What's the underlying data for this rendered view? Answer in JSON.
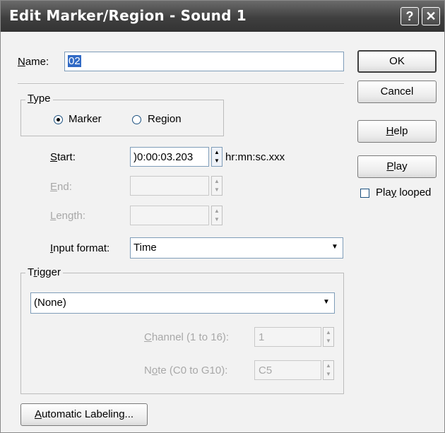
{
  "window": {
    "title": "Edit Marker/Region - Sound 1",
    "help_glyph": "?",
    "close_glyph": "✕"
  },
  "name": {
    "label_pre": "",
    "label_key": "N",
    "label_post": "ame:",
    "value": "02"
  },
  "type": {
    "group_key": "T",
    "group_rest": "ype",
    "marker_label": "Marker",
    "region_label": "Region",
    "selected": "Marker"
  },
  "start": {
    "key": "S",
    "rest": "tart:",
    "value": ")0:00:03.203",
    "format": "hr:mn:sc.xxx"
  },
  "end": {
    "key": "E",
    "rest": "nd:",
    "value": ""
  },
  "length": {
    "key": "L",
    "rest": "ength:",
    "value": ""
  },
  "input_format": {
    "key": "I",
    "rest": "nput format:",
    "value": "Time"
  },
  "trigger": {
    "group_pre": "T",
    "group_key": "r",
    "group_post": "igger",
    "value": "(None)",
    "channel": {
      "key": "C",
      "rest": "hannel (1 to 16):",
      "value": "1"
    },
    "note": {
      "pre": "N",
      "key": "o",
      "rest": "te (C0 to G10):",
      "value": "C5"
    }
  },
  "buttons": {
    "ok": "OK",
    "cancel": "Cancel",
    "help_key": "H",
    "help_rest": "elp",
    "play_key": "P",
    "play_rest": "lay",
    "auto_key": "A",
    "auto_rest": "utomatic Labeling..."
  },
  "play_looped": {
    "pre": "Pla",
    "key": "y",
    "rest": " looped",
    "checked": false
  }
}
